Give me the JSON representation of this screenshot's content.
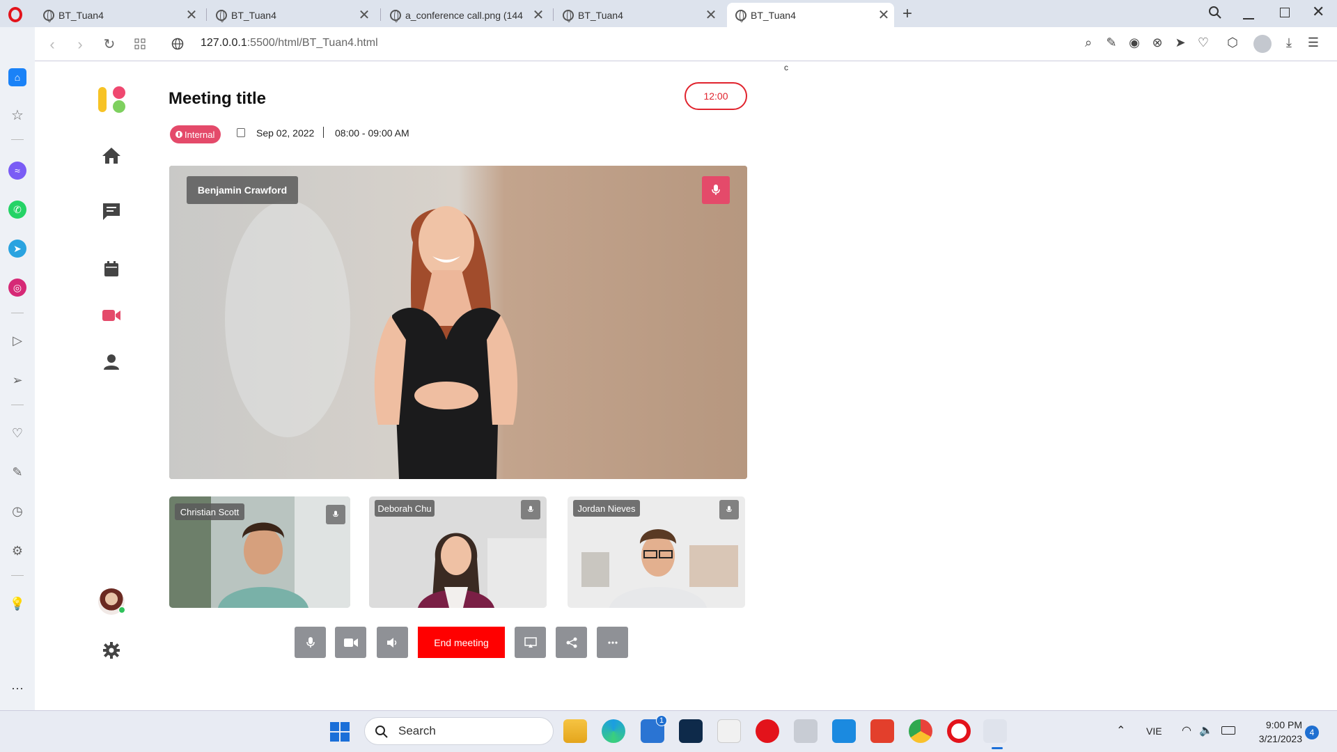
{
  "browser": {
    "tabs": [
      {
        "title": "BT_Tuan4"
      },
      {
        "title": "BT_Tuan4"
      },
      {
        "title": "a_conference call.png (144"
      },
      {
        "title": "BT_Tuan4"
      },
      {
        "title": "BT_Tuan4"
      }
    ],
    "active_tab": 4,
    "url_host": "127.0.0.1",
    "url_path": ":5500/html/BT_Tuan4.html",
    "stray_char": "c"
  },
  "meeting": {
    "title": "Meeting title",
    "timer": "12:00",
    "badge": "Internal",
    "date": "Sep 02, 2022",
    "time": "08:00 - 09:00 AM",
    "main_speaker": "Benjamin Crawford",
    "participants": [
      {
        "name": "Christian Scott"
      },
      {
        "name": "Deborah Chu"
      },
      {
        "name": "Jordan Nieves"
      }
    ],
    "end_label": "End meeting"
  },
  "sidebar_nav": [
    "home-icon",
    "chat-icon",
    "calendar-icon",
    "video-icon",
    "user-icon",
    "settings-icon"
  ],
  "colors": {
    "accent": "#e44a6a",
    "end": "#ff0000",
    "timer": "#e0232d",
    "control": "#8f9196"
  },
  "taskbar": {
    "search_placeholder": "Search",
    "language": "VIE",
    "time": "9:00 PM",
    "date": "3/21/2023",
    "notifications": "4",
    "store_badge": "1"
  }
}
